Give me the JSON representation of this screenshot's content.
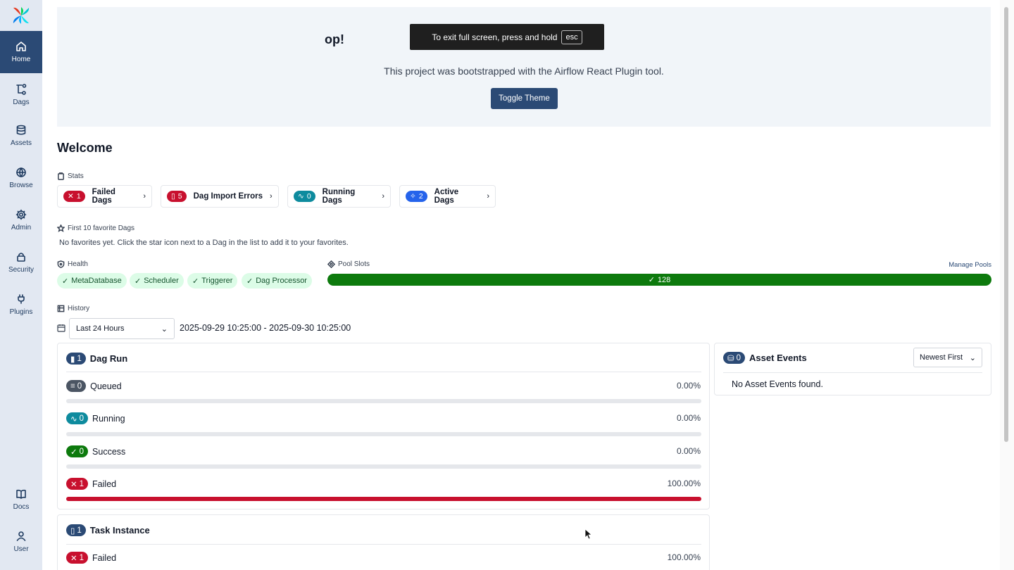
{
  "sidebar": {
    "items": [
      {
        "label": "Home",
        "icon": "home-icon"
      },
      {
        "label": "Dags",
        "icon": "dags-icon"
      },
      {
        "label": "Assets",
        "icon": "database-icon"
      },
      {
        "label": "Browse",
        "icon": "globe-icon"
      },
      {
        "label": "Admin",
        "icon": "gear-icon"
      },
      {
        "label": "Security",
        "icon": "lock-icon"
      },
      {
        "label": "Plugins",
        "icon": "plug-icon"
      }
    ],
    "bottom": [
      {
        "label": "Docs",
        "icon": "book-icon"
      },
      {
        "label": "User",
        "icon": "user-icon"
      }
    ]
  },
  "plugin": {
    "title": "op!",
    "description": "This project was bootstrapped with the Airflow React Plugin tool.",
    "toggle_label": "Toggle Theme"
  },
  "fullscreen_toast": {
    "text": "To exit full screen, press and hold",
    "key": "esc"
  },
  "welcome": "Welcome",
  "stats": {
    "label": "Stats",
    "cards": [
      {
        "count": "1",
        "label": "Failed Dags",
        "color": "#c8102e"
      },
      {
        "count": "5",
        "label": "Dag Import Errors",
        "color": "#c8102e"
      },
      {
        "count": "0",
        "label": "Running Dags",
        "color": "#0e8b9e"
      },
      {
        "count": "2",
        "label": "Active Dags",
        "color": "#2563eb"
      }
    ]
  },
  "favorites": {
    "label": "First 10 favorite Dags",
    "empty": "No favorites yet. Click the star icon next to a Dag in the list to add it to your favorites."
  },
  "health": {
    "label": "Health",
    "items": [
      "MetaDatabase",
      "Scheduler",
      "Triggerer",
      "Dag Processor"
    ]
  },
  "pool_slots": {
    "label": "Pool Slots",
    "value": "128",
    "manage": "Manage Pools"
  },
  "history": {
    "label": "History",
    "range": "Last 24 Hours",
    "range_text": "2025-09-29 10:25:00 - 2025-09-30 10:25:00"
  },
  "dag_run": {
    "count": "1",
    "title": "Dag Run",
    "rows": [
      {
        "count": "0",
        "label": "Queued",
        "pct": "0.00%",
        "color": "#4b5563",
        "fill": 0
      },
      {
        "count": "0",
        "label": "Running",
        "pct": "0.00%",
        "color": "#0e8b9e",
        "fill": 0
      },
      {
        "count": "0",
        "label": "Success",
        "pct": "0.00%",
        "color": "#0d7a0d",
        "fill": 0
      },
      {
        "count": "1",
        "label": "Failed",
        "pct": "100.00%",
        "color": "#c8102e",
        "fill": 100
      }
    ]
  },
  "task_instance": {
    "count": "1",
    "title": "Task Instance",
    "rows": [
      {
        "count": "1",
        "label": "Failed",
        "pct": "100.00%",
        "color": "#c8102e"
      }
    ]
  },
  "asset_events": {
    "count": "0",
    "title": "Asset Events",
    "sort": "Newest First",
    "empty": "No Asset Events found."
  }
}
